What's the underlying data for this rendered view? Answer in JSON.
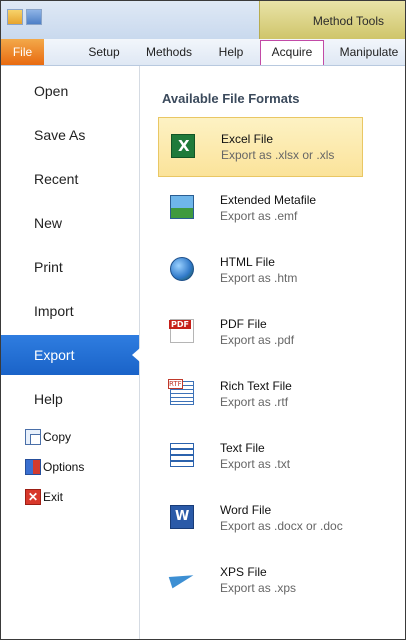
{
  "ribbon": {
    "context_group_label": "Method Tools",
    "tabs": [
      {
        "label": "File"
      },
      {
        "label": "Setup"
      },
      {
        "label": "Methods"
      },
      {
        "label": "Help"
      },
      {
        "label": "Acquire"
      },
      {
        "label": "Manipulate"
      }
    ]
  },
  "backstage": {
    "menu": [
      {
        "label": "Open"
      },
      {
        "label": "Save As"
      },
      {
        "label": "Recent"
      },
      {
        "label": "New"
      },
      {
        "label": "Print"
      },
      {
        "label": "Import"
      },
      {
        "label": "Export"
      },
      {
        "label": "Help"
      }
    ],
    "selected_menu": "Export",
    "small_items": [
      {
        "label": "Copy",
        "icon": "copy-icon"
      },
      {
        "label": "Options",
        "icon": "options-icon"
      },
      {
        "label": "Exit",
        "icon": "exit-icon"
      }
    ]
  },
  "export_panel": {
    "heading": "Available File Formats",
    "formats": [
      {
        "name": "Excel File",
        "desc": "Export as .xlsx or .xls",
        "icon": "excel-icon"
      },
      {
        "name": "Extended Metafile",
        "desc": "Export as .emf",
        "icon": "emf-icon"
      },
      {
        "name": "HTML File",
        "desc": "Export as .htm",
        "icon": "html-icon"
      },
      {
        "name": "PDF File",
        "desc": "Export as .pdf",
        "icon": "pdf-icon"
      },
      {
        "name": "Rich Text File",
        "desc": "Export as .rtf",
        "icon": "rtf-icon"
      },
      {
        "name": "Text File",
        "desc": "Export as .txt",
        "icon": "text-icon"
      },
      {
        "name": "Word File",
        "desc": "Export as .docx or .doc",
        "icon": "word-icon"
      },
      {
        "name": "XPS File",
        "desc": "Export as .xps",
        "icon": "xps-icon"
      }
    ],
    "selected_format": "Excel File"
  },
  "colors": {
    "file_tab": "#e86a10",
    "selected_menu": "#1a63c8",
    "selected_format_bg": "#fbe39a",
    "context_group": "#cfc56a"
  }
}
